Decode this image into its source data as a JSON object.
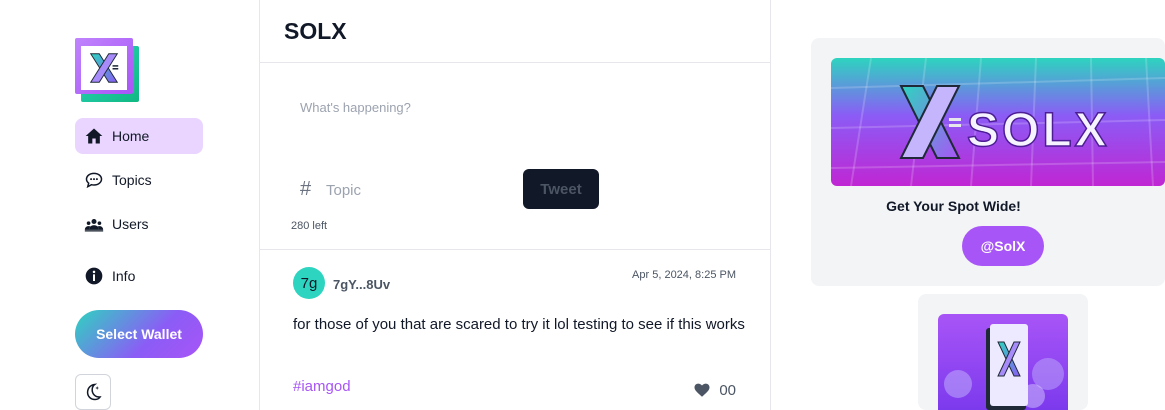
{
  "sidebar": {
    "logo_icon": "solx-logo-icon",
    "items": [
      {
        "label": "Home",
        "icon": "home-icon",
        "active": true
      },
      {
        "label": "Topics",
        "icon": "chat-bubble-icon",
        "active": false
      },
      {
        "label": "Users",
        "icon": "users-icon",
        "active": false
      },
      {
        "label": "Info",
        "icon": "info-icon",
        "active": false
      }
    ],
    "wallet_button": "Select Wallet",
    "theme_icon": "moon-icon"
  },
  "header": {
    "title": "SOLX"
  },
  "composer": {
    "placeholder": "What's happening?",
    "topic_placeholder": "Topic",
    "tweet_button": "Tweet",
    "chars_left": "280 left"
  },
  "post": {
    "avatar_text": "7g",
    "author": "7gY...8Uv",
    "timestamp": "Apr 5, 2024, 8:25 PM",
    "text": "for those of you that are scared to try it lol testing to see if this works",
    "tag": "#iamgod",
    "likes": "00"
  },
  "promo": {
    "banner_text": "SOLX",
    "title": "Get Your Spot Wide!",
    "handle_button": "@SolX"
  },
  "colors": {
    "accent": "#a855f7",
    "teal": "#2dd4bf",
    "active_nav": "#e9d5ff",
    "dark": "#111827"
  }
}
